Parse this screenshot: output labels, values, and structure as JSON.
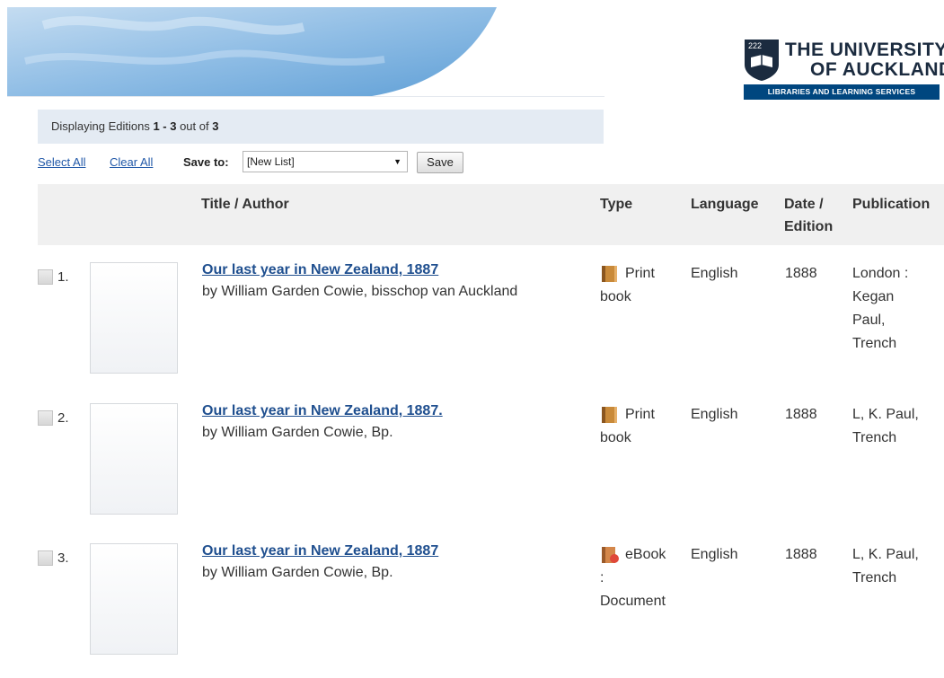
{
  "logo": {
    "line1": "THE UNIVERSITY",
    "line2": "OF AUCKLAND",
    "subtitle": "LIBRARIES AND LEARNING SERVICES"
  },
  "display": {
    "prefix": "Displaying Editions ",
    "range": "1 - 3",
    "mid": " out of ",
    "total": "3"
  },
  "toolbar": {
    "select_all": "Select All",
    "clear_all": "Clear All",
    "save_to_label": "Save to:",
    "save_to_value": "[New List]",
    "save_button": "Save"
  },
  "table": {
    "headers": {
      "title_author": "Title / Author",
      "type": "Type",
      "language": "Language",
      "date_line1": "Date /",
      "date_line2": "Edition",
      "publication": "Publication"
    },
    "rows": [
      {
        "num": "1.",
        "title": "Our last year in New Zealand, 1887",
        "author": "by William Garden Cowie, bisschop van Auckland",
        "type_line1": "Print",
        "type_line2": "book",
        "type_line3": "",
        "language": "English",
        "date": "1888",
        "publication_lines": [
          "London :",
          "Kegan",
          "Paul,",
          "Trench"
        ]
      },
      {
        "num": "2.",
        "title": "Our last year in New Zealand, 1887.",
        "author": "by William Garden Cowie, Bp.",
        "type_line1": "Print",
        "type_line2": "book",
        "type_line3": "",
        "language": "English",
        "date": "1888",
        "publication_lines": [
          "L, K. Paul,",
          "Trench"
        ]
      },
      {
        "num": "3.",
        "title": "Our last year in New Zealand, 1887",
        "author": "by William Garden Cowie, Bp.",
        "type_line1": "eBook",
        "type_line2": ":",
        "type_line3": "Document",
        "language": "English",
        "date": "1888",
        "publication_lines": [
          "L, K. Paul,",
          "Trench"
        ]
      }
    ]
  },
  "icons": {
    "print_book": "book-icon",
    "ebook": "ebook-icon"
  },
  "colors": {
    "link": "#1f4f8f",
    "brand": "#00467f",
    "display_bar": "#e4ebf3",
    "header_bg": "#f0f0f0"
  }
}
